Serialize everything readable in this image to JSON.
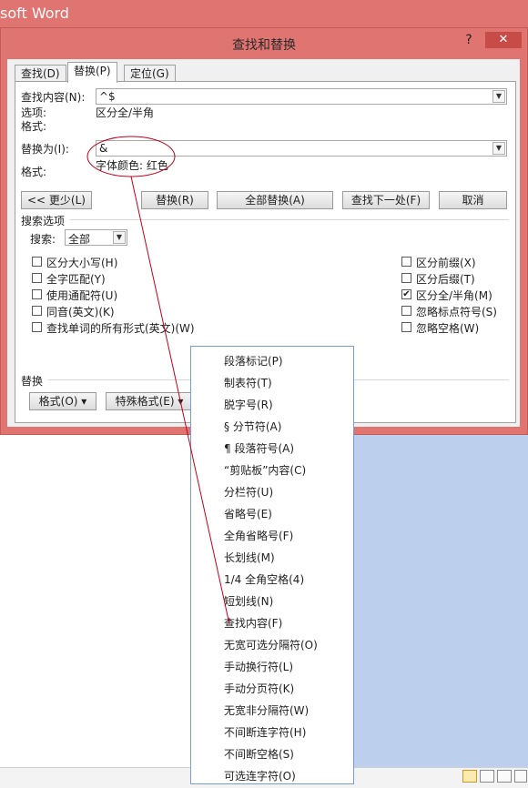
{
  "word": {
    "title_fragment": "soft Word"
  },
  "dialog": {
    "title": "查找和替换",
    "help": "?",
    "close": "✕",
    "tabs": [
      "查找(D)",
      "替换(P)",
      "定位(G)"
    ],
    "find_label": "查找内容(N):",
    "find_value": "^$",
    "options_label": "选项:",
    "options_value": "区分全/半角",
    "format_label_1": "格式:",
    "replace_label": "替换为(I):",
    "replace_value": "&",
    "format_label_2": "格式:",
    "replace_format_value": "字体颜色: 红色",
    "buttons": {
      "less": "<< 更少(L)",
      "replace": "替换(R)",
      "replace_all": "全部替换(A)",
      "find_next": "查找下一处(F)",
      "cancel": "取消"
    },
    "search_options_heading": "搜索选项",
    "search_label": "搜索:",
    "search_value": "全部",
    "left_options": [
      {
        "label": "区分大小写(H)",
        "checked": false
      },
      {
        "label": "全字匹配(Y)",
        "checked": false
      },
      {
        "label": "使用通配符(U)",
        "checked": false
      },
      {
        "label": "同音(英文)(K)",
        "checked": false
      },
      {
        "label": "查找单词的所有形式(英文)(W)",
        "checked": false
      }
    ],
    "right_options": [
      {
        "label": "区分前缀(X)",
        "checked": false
      },
      {
        "label": "区分后缀(T)",
        "checked": false
      },
      {
        "label": "区分全/半角(M)",
        "checked": true
      },
      {
        "label": "忽略标点符号(S)",
        "checked": false
      },
      {
        "label": "忽略空格(W)",
        "checked": false
      }
    ],
    "replace_heading": "替换",
    "format_button": "格式(O) ▾",
    "special_button": "特殊格式(E) ▾"
  },
  "special_menu": [
    "段落标记(P)",
    "制表符(T)",
    "脱字号(R)",
    "§ 分节符(A)",
    "¶ 段落符号(A)",
    "“剪贴板”内容(C)",
    "分栏符(U)",
    "省略号(E)",
    "全角省略号(F)",
    "长划线(M)",
    "1/4 全角空格(4)",
    "短划线(N)",
    "查找内容(F)",
    "无宽可选分隔符(O)",
    "手动换行符(L)",
    "手动分页符(K)",
    "无宽非分隔符(W)",
    "不间断连字符(H)",
    "不间断空格(S)",
    "可选连字符(O)"
  ],
  "colors": {
    "window_accent": "#e07470",
    "close_button": "#c74b47",
    "annotation": "#c0001a",
    "popup_border": "#7a9ad0"
  }
}
